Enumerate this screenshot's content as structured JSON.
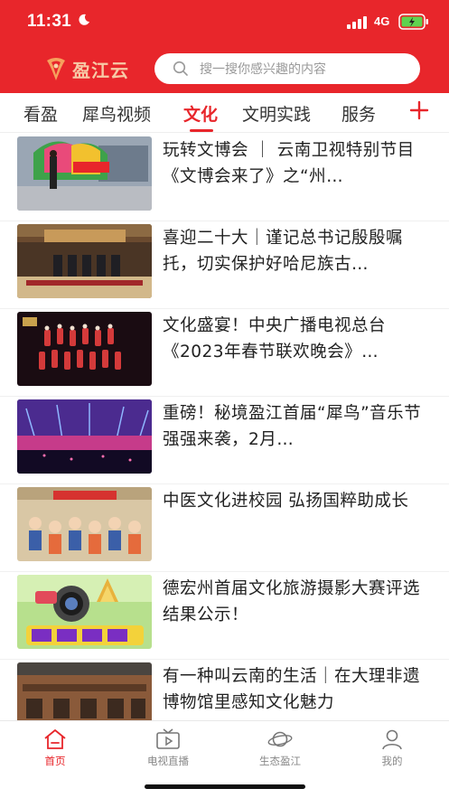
{
  "status": {
    "time": "11:31",
    "network": "4G"
  },
  "header": {
    "logo_text": "盈江云",
    "search_placeholder": "搜一搜你感兴趣的内容"
  },
  "tabs": [
    {
      "label": "看盈"
    },
    {
      "label": "犀鸟视频"
    },
    {
      "label": "文化",
      "active": true
    },
    {
      "label": "文明实践"
    },
    {
      "label": "服务"
    }
  ],
  "news": [
    {
      "title": "玩转文博会 ｜ 云南卫视特别节目《文博会来了》之“州…"
    },
    {
      "title": "喜迎二十大｜谨记总书记殷殷嘱托，切实保护好哈尼族古…"
    },
    {
      "title": "文化盛宴！中央广播电视总台《2023年春节联欢晚会》…"
    },
    {
      "title": "重磅！秘境盈江首届“犀鸟”音乐节强强来袭，2月…"
    },
    {
      "title": "中医文化进校园 弘扬国粹助成长"
    },
    {
      "title": "德宏州首届文化旅游摄影大赛评选结果公示！"
    },
    {
      "title": "有一种叫云南的生活｜在大理非遗博物馆里感知文化魅力"
    }
  ],
  "bottom_nav": [
    {
      "label": "首页",
      "active": true
    },
    {
      "label": "电视直播"
    },
    {
      "label": "生态盈江"
    },
    {
      "label": "我的"
    }
  ],
  "colors": {
    "brand_red": "#e8262b"
  }
}
